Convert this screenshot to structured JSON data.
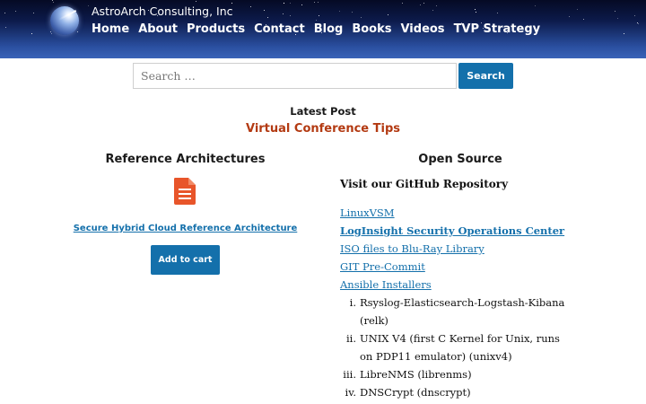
{
  "header": {
    "site_title": "AstroArch Consulting, Inc",
    "nav": [
      "Home",
      "About",
      "Products",
      "Contact",
      "Blog",
      "Books",
      "Videos",
      "TVP Strategy"
    ]
  },
  "search": {
    "placeholder": "Search …",
    "button_label": "Search"
  },
  "latest_post": {
    "label": "Latest Post",
    "title": "Virtual Conference Tips"
  },
  "reference": {
    "heading": "Reference Architectures",
    "icon": "document-icon",
    "link": "Secure Hybrid Cloud Reference Architecture",
    "button_label": "Add to cart"
  },
  "open_source": {
    "heading": "Open Source",
    "github_text": "Visit our GitHub Repository",
    "links": [
      {
        "label": "LinuxVSM",
        "bold": false
      },
      {
        "label": "LogInsight Security Operations Center",
        "bold": true
      },
      {
        "label": "ISO files to Blu-Ray Library",
        "bold": false
      },
      {
        "label": "GIT Pre-Commit",
        "bold": false
      },
      {
        "label": "Ansible Installers",
        "bold": false
      }
    ],
    "sublist": [
      {
        "num": "i.",
        "text": "Rsyslog-Elasticsearch-Logstash-Kibana (relk)"
      },
      {
        "num": "ii.",
        "text": "UNIX V4 (first C Kernel for Unix, runs on PDP11 emulator) (unixv4)"
      },
      {
        "num": "iii.",
        "text": "LibreNMS (librenms)"
      },
      {
        "num": "iv.",
        "text": "DNSCrypt (dnscrypt)"
      }
    ]
  },
  "colors": {
    "accent": "#1470ab",
    "post_title": "#b33a12",
    "icon": "#e8552a"
  }
}
